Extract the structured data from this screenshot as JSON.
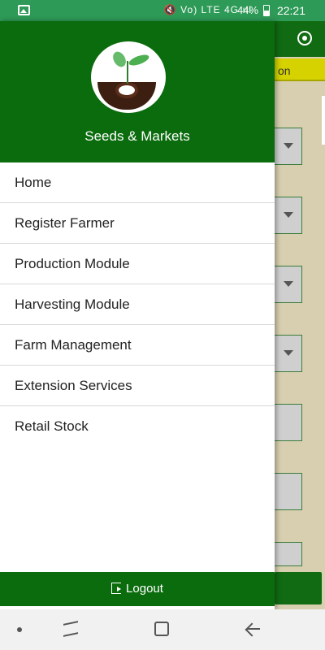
{
  "status_bar": {
    "indicators": "🔇 Vo) LTE 4G ıll",
    "battery_percent": "44%",
    "time": "22:21"
  },
  "background_app": {
    "banner_fragment": "on"
  },
  "drawer": {
    "brand": "Seeds & Markets",
    "menu_items": [
      {
        "label": "Home"
      },
      {
        "label": "Register Farmer"
      },
      {
        "label": "Production Module"
      },
      {
        "label": "Harvesting Module"
      },
      {
        "label": "Farm Management"
      },
      {
        "label": "Extension Services"
      },
      {
        "label": "Retail Stock"
      }
    ],
    "logout_label": "Logout"
  },
  "colors": {
    "status_bar": "#2e9a57",
    "drawer_header": "#0b6c0e",
    "toolbar": "#116b12",
    "banner": "#d5d200"
  },
  "icons": {
    "status": [
      "gallery-icon",
      "mute-icon",
      "signal-icon",
      "battery-icon"
    ],
    "toolbar": [
      "location-icon"
    ],
    "logout": "logout-icon",
    "navigation": [
      "nav-dot-icon",
      "recent-apps-icon",
      "home-icon",
      "back-icon"
    ]
  }
}
